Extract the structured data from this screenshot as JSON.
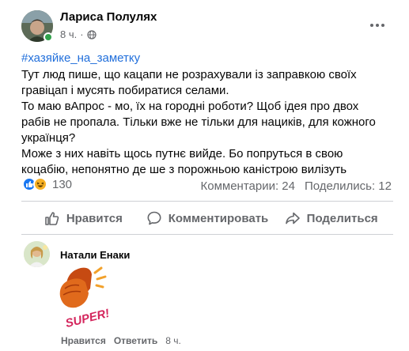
{
  "post": {
    "author": "Лариса Полулях",
    "time": "8 ч.",
    "privacy_icon": "globe-icon",
    "more_icon": "more-horizontal-icon",
    "hashtag": "#хазяйке_на_заметку",
    "text_lines": [
      "Тут люд пише, що кацапи не розрахували із заправкою своїх",
      "гравіцап і мусять побиратися селами.",
      "То маю вАпрос - мо, їх на городні роботи? Щоб ідея про двох",
      "рабів не пропала. Тільки вже не тільки для нациків, для кожного",
      "українця?",
      "Може з них навіть щось путнє вийде. Бо попруться в свою",
      "коцабію, непонятно де ше з порожньою каністрою вилізуть"
    ]
  },
  "stats": {
    "reaction_icons": [
      "like-icon",
      "haha-icon"
    ],
    "reaction_count": "130",
    "comments": "Комментарии: 24",
    "shares": "Поделились: 12"
  },
  "actions": {
    "like": "Нравится",
    "comment": "Комментировать",
    "share": "Поделиться"
  },
  "comment": {
    "author": "Натали Енаки",
    "sticker_text": "SUPER!",
    "like_label": "Нравится",
    "reply_label": "Ответить",
    "time": "8 ч."
  },
  "colors": {
    "link_blue": "#216fdb",
    "like_blue": "#1877f2",
    "haha_yellow": "#f7b125",
    "online_green": "#31a24c",
    "secondary_text": "#65676b"
  }
}
